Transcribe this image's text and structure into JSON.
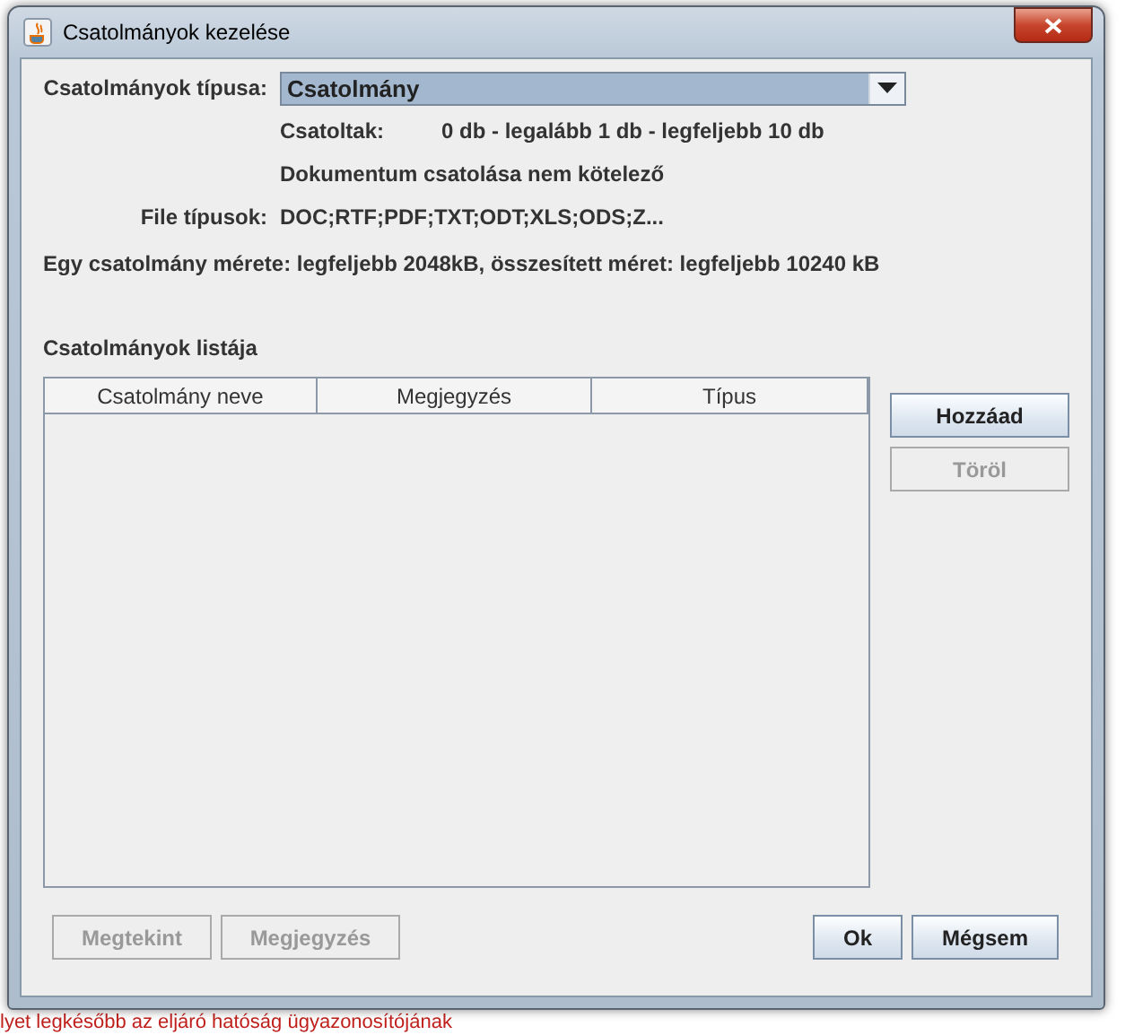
{
  "window": {
    "title": "Csatolmányok kezelése"
  },
  "type_field": {
    "label": "Csatolmányok típusa:",
    "value": "Csatolmány"
  },
  "attached": {
    "label": "Csatoltak:",
    "value": "0 db - legalább 1 db - legfeljebb 10 db"
  },
  "note": "Dokumentum csatolása nem kötelező",
  "file_types": {
    "label": "File típusok:",
    "value": "DOC;RTF;PDF;TXT;ODT;XLS;ODS;Z..."
  },
  "size_info": "Egy csatolmány mérete: legfeljebb 2048kB, összesített méret: legfeljebb 10240 kB",
  "list_title": "Csatolmányok listája",
  "table": {
    "columns": [
      "Csatolmány neve",
      "Megjegyzés",
      "Típus"
    ]
  },
  "side_buttons": [
    {
      "label": "Hozzáad",
      "disabled": false
    },
    {
      "label": "Töröl",
      "disabled": true
    }
  ],
  "bottom_left_buttons": [
    {
      "label": "Megtekint",
      "disabled": true
    },
    {
      "label": "Megjegyzés",
      "disabled": true
    }
  ],
  "bottom_right_buttons": [
    {
      "label": "Ok",
      "disabled": false
    },
    {
      "label": "Mégsem",
      "disabled": false
    }
  ],
  "background_text": "lyet legkésőbb az eljáró hatóság ügyazonosítójának"
}
